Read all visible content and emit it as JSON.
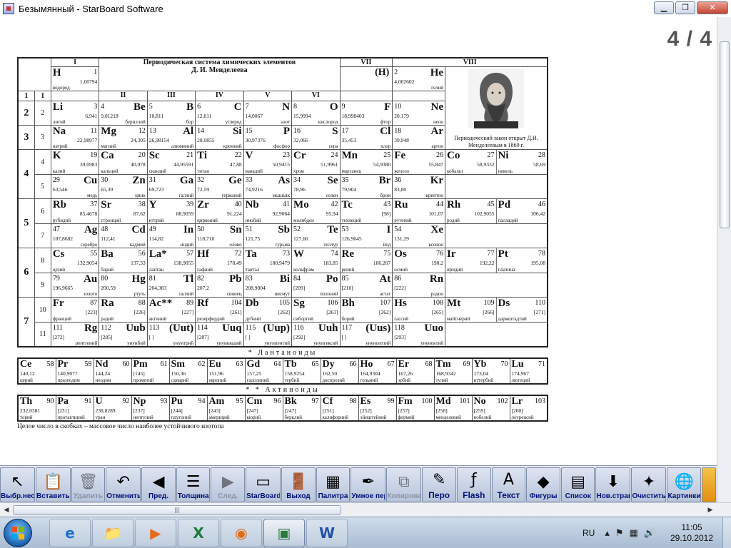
{
  "window": {
    "title": "Безымянный - StarBoard Software",
    "minimize": "▁",
    "maximize": "❐",
    "close": "✕"
  },
  "canvas": {
    "page_indicator": "4 / 4"
  },
  "table": {
    "groups": [
      "I",
      "II",
      "III",
      "IV",
      "V",
      "VI",
      "VII",
      "VIII"
    ],
    "title_line1": "Периодическая система химических элементов",
    "title_line2": "Д. И. Менделеева",
    "h_group7": "(H)",
    "periods": [
      "1",
      "2",
      "3",
      "4",
      "5",
      "6",
      "7"
    ],
    "rows": [
      "1",
      "2",
      "3",
      "4",
      "5",
      "6",
      "7",
      "8",
      "9",
      "10",
      "11"
    ],
    "portrait_caption": "Периодический закон открыт Д.И. Менделеевым в 1869 г.",
    "elements": {
      "H": {
        "sym": "H",
        "num": "1",
        "mass": "1,00794",
        "name": "водород"
      },
      "He": {
        "sym": "He",
        "num": "2",
        "mass": "4,002602",
        "name": "гелий"
      },
      "Li": {
        "sym": "Li",
        "num": "3",
        "mass": "6,941",
        "name": "литий"
      },
      "Be": {
        "sym": "Be",
        "num": "4",
        "mass": "9,01218",
        "name": "бериллий"
      },
      "B": {
        "sym": "B",
        "num": "5",
        "mass": "10,811",
        "name": "бор"
      },
      "C": {
        "sym": "C",
        "num": "6",
        "mass": "12,011",
        "name": "углерод"
      },
      "N": {
        "sym": "N",
        "num": "7",
        "mass": "14,0067",
        "name": "азот"
      },
      "O": {
        "sym": "O",
        "num": "8",
        "mass": "15,9994",
        "name": "кислород"
      },
      "F": {
        "sym": "F",
        "num": "9",
        "mass": "18,998403",
        "name": "фтор"
      },
      "Ne": {
        "sym": "Ne",
        "num": "10",
        "mass": "20,179",
        "name": "неон"
      },
      "Na": {
        "sym": "Na",
        "num": "11",
        "mass": "22,98977",
        "name": "натрий"
      },
      "Mg": {
        "sym": "Mg",
        "num": "12",
        "mass": "24,305",
        "name": "магний"
      },
      "Al": {
        "sym": "Al",
        "num": "13",
        "mass": "26,98154",
        "name": "алюминий"
      },
      "Si": {
        "sym": "Si",
        "num": "14",
        "mass": "28,0855",
        "name": "кремний"
      },
      "P": {
        "sym": "P",
        "num": "15",
        "mass": "30,97376",
        "name": "фосфор"
      },
      "S": {
        "sym": "S",
        "num": "16",
        "mass": "32,066",
        "name": "сера"
      },
      "Cl": {
        "sym": "Cl",
        "num": "17",
        "mass": "35,453",
        "name": "хлор"
      },
      "Ar": {
        "sym": "Ar",
        "num": "18",
        "mass": "39,948",
        "name": "аргон"
      },
      "K": {
        "sym": "K",
        "num": "19",
        "mass": "39,0983",
        "name": "калий"
      },
      "Ca": {
        "sym": "Ca",
        "num": "20",
        "mass": "40,078",
        "name": "кальций"
      },
      "Sc": {
        "sym": "Sc",
        "num": "21",
        "mass": "44,95591",
        "name": "скандий"
      },
      "Ti": {
        "sym": "Ti",
        "num": "22",
        "mass": "47,88",
        "name": "титан"
      },
      "V": {
        "sym": "V",
        "num": "23",
        "mass": "50,9415",
        "name": "ванадий"
      },
      "Cr": {
        "sym": "Cr",
        "num": "24",
        "mass": "51,9961",
        "name": "хром"
      },
      "Mn": {
        "sym": "Mn",
        "num": "25",
        "mass": "54,9380",
        "name": "марганец"
      },
      "Fe": {
        "sym": "Fe",
        "num": "26",
        "mass": "55,847",
        "name": "железо"
      },
      "Co": {
        "sym": "Co",
        "num": "27",
        "mass": "58,9332",
        "name": "кобальт"
      },
      "Ni": {
        "sym": "Ni",
        "num": "28",
        "mass": "58,69",
        "name": "никель"
      },
      "Cu": {
        "sym": "Cu",
        "num": "29",
        "mass": "63,546",
        "name": "медь"
      },
      "Zn": {
        "sym": "Zn",
        "num": "30",
        "mass": "65,39",
        "name": "цинк"
      },
      "Ga": {
        "sym": "Ga",
        "num": "31",
        "mass": "69,723",
        "name": "галлий"
      },
      "Ge": {
        "sym": "Ge",
        "num": "32",
        "mass": "72,59",
        "name": "германий"
      },
      "As": {
        "sym": "As",
        "num": "33",
        "mass": "74,9216",
        "name": "мышьяк"
      },
      "Se": {
        "sym": "Se",
        "num": "34",
        "mass": "78,96",
        "name": "селен"
      },
      "Br": {
        "sym": "Br",
        "num": "35",
        "mass": "79,904",
        "name": "бром"
      },
      "Kr": {
        "sym": "Kr",
        "num": "36",
        "mass": "83,80",
        "name": "криптон"
      },
      "Rb": {
        "sym": "Rb",
        "num": "37",
        "mass": "85,4678",
        "name": "рубидий"
      },
      "Sr": {
        "sym": "Sr",
        "num": "38",
        "mass": "87,62",
        "name": "стронций"
      },
      "Y": {
        "sym": "Y",
        "num": "39",
        "mass": "88,9059",
        "name": "иттрий"
      },
      "Zr": {
        "sym": "Zr",
        "num": "40",
        "mass": "91,224",
        "name": "цирконий"
      },
      "Nb": {
        "sym": "Nb",
        "num": "41",
        "mass": "92,9064",
        "name": "ниобий"
      },
      "Mo": {
        "sym": "Mo",
        "num": "42",
        "mass": "95,94",
        "name": "молибден"
      },
      "Tc": {
        "sym": "Tc",
        "num": "43",
        "mass": "[98]",
        "name": "технеций"
      },
      "Ru": {
        "sym": "Ru",
        "num": "44",
        "mass": "101,07",
        "name": "рутений"
      },
      "Rh": {
        "sym": "Rh",
        "num": "45",
        "mass": "102,9055",
        "name": "родий"
      },
      "Pd": {
        "sym": "Pd",
        "num": "46",
        "mass": "106,42",
        "name": "палладий"
      },
      "Ag": {
        "sym": "Ag",
        "num": "47",
        "mass": "107,8682",
        "name": "серебро"
      },
      "Cd": {
        "sym": "Cd",
        "num": "48",
        "mass": "112,41",
        "name": "кадмий"
      },
      "In": {
        "sym": "In",
        "num": "49",
        "mass": "114,82",
        "name": "индий"
      },
      "Sn": {
        "sym": "Sn",
        "num": "50",
        "mass": "118,710",
        "name": "олово"
      },
      "Sb": {
        "sym": "Sb",
        "num": "51",
        "mass": "121,75",
        "name": "сурьма"
      },
      "Te": {
        "sym": "Te",
        "num": "52",
        "mass": "127,60",
        "name": "теллур"
      },
      "I": {
        "sym": "I",
        "num": "53",
        "mass": "126,9045",
        "name": "йод"
      },
      "Xe": {
        "sym": "Xe",
        "num": "54",
        "mass": "131,29",
        "name": "ксенон"
      },
      "Cs": {
        "sym": "Cs",
        "num": "55",
        "mass": "132,9054",
        "name": "цезий"
      },
      "Ba": {
        "sym": "Ba",
        "num": "56",
        "mass": "137,33",
        "name": "барий"
      },
      "La": {
        "sym": "La*",
        "num": "57",
        "mass": "138,9055",
        "name": "лантан"
      },
      "Hf": {
        "sym": "Hf",
        "num": "72",
        "mass": "178,49",
        "name": "гафний"
      },
      "Ta": {
        "sym": "Ta",
        "num": "73",
        "mass": "180,9479",
        "name": "тантал"
      },
      "W": {
        "sym": "W",
        "num": "74",
        "mass": "183,85",
        "name": "вольфрам"
      },
      "Re": {
        "sym": "Re",
        "num": "75",
        "mass": "186,207",
        "name": "рений"
      },
      "Os": {
        "sym": "Os",
        "num": "76",
        "mass": "190,2",
        "name": "осмий"
      },
      "Ir": {
        "sym": "Ir",
        "num": "77",
        "mass": "192,22",
        "name": "иридий"
      },
      "Pt": {
        "sym": "Pt",
        "num": "78",
        "mass": "195,08",
        "name": "платина"
      },
      "Au": {
        "sym": "Au",
        "num": "79",
        "mass": "196,9665",
        "name": "золото"
      },
      "Hg": {
        "sym": "Hg",
        "num": "80",
        "mass": "200,59",
        "name": "ртуть"
      },
      "Tl": {
        "sym": "Tl",
        "num": "81",
        "mass": "204,383",
        "name": "таллий"
      },
      "Pb": {
        "sym": "Pb",
        "num": "82",
        "mass": "207,2",
        "name": "свинец"
      },
      "Bi": {
        "sym": "Bi",
        "num": "83",
        "mass": "208,9804",
        "name": "висмут"
      },
      "Po": {
        "sym": "Po",
        "num": "84",
        "mass": "[209]",
        "name": "полоний"
      },
      "At": {
        "sym": "At",
        "num": "85",
        "mass": "[210]",
        "name": "астат"
      },
      "Rn": {
        "sym": "Rn",
        "num": "86",
        "mass": "[222]",
        "name": "радон"
      },
      "Fr": {
        "sym": "Fr",
        "num": "87",
        "mass": "[223]",
        "name": "франций"
      },
      "Ra": {
        "sym": "Ra",
        "num": "88",
        "mass": "[226]",
        "name": "радий"
      },
      "Ac": {
        "sym": "Ac**",
        "num": "89",
        "mass": "[227]",
        "name": "актиний"
      },
      "Rf": {
        "sym": "Rf",
        "num": "104",
        "mass": "[261]",
        "name": "резерфордий"
      },
      "Db": {
        "sym": "Db",
        "num": "105",
        "mass": "[262]",
        "name": "дубний"
      },
      "Sg": {
        "sym": "Sg",
        "num": "106",
        "mass": "[263]",
        "name": "сиборгий"
      },
      "Bh": {
        "sym": "Bh",
        "num": "107",
        "mass": "[262]",
        "name": "борий"
      },
      "Hs": {
        "sym": "Hs",
        "num": "108",
        "mass": "[265]",
        "name": "гассий"
      },
      "Mt": {
        "sym": "Mt",
        "num": "109",
        "mass": "[266]",
        "name": "майтнерий"
      },
      "Ds": {
        "sym": "Ds",
        "num": "110",
        "mass": "[271]",
        "name": "дармштадтий"
      },
      "Rg": {
        "sym": "Rg",
        "num": "111",
        "mass": "[272]",
        "name": "рентгений"
      },
      "Uub": {
        "sym": "Uub",
        "num": "112",
        "mass": "[285]",
        "name": "унунбий"
      },
      "Uut": {
        "sym": "(Uut)",
        "num": "113",
        "mass": "[  ]",
        "name": "унунтрий"
      },
      "Uuq": {
        "sym": "Uuq",
        "num": "114",
        "mass": "[287]",
        "name": "унунквадий"
      },
      "Uup": {
        "sym": "(Uup)",
        "num": "115",
        "mass": "[  ]",
        "name": "унунпентий"
      },
      "Uuh": {
        "sym": "Uuh",
        "num": "116",
        "mass": "[292]",
        "name": "унунгексий"
      },
      "Uus": {
        "sym": "(Uus)",
        "num": "117",
        "mass": "[  ]",
        "name": "унунсептий"
      },
      "Uuo": {
        "sym": "Uuo",
        "num": "118",
        "mass": "[293]",
        "name": "унуноктий"
      }
    },
    "lanthanides_label": "* Лантаноиды",
    "actinides_label": "* * Актиноиды",
    "lanthanides": [
      {
        "sym": "Ce",
        "num": "58",
        "mass": "140,12",
        "name": "церий"
      },
      {
        "sym": "Pr",
        "num": "59",
        "mass": "140,9077",
        "name": "празеодим"
      },
      {
        "sym": "Nd",
        "num": "60",
        "mass": "144,24",
        "name": "неодим"
      },
      {
        "sym": "Pm",
        "num": "61",
        "mass": "[145]",
        "name": "прометий"
      },
      {
        "sym": "Sm",
        "num": "62",
        "mass": "150,36",
        "name": "самарий"
      },
      {
        "sym": "Eu",
        "num": "63",
        "mass": "151,96",
        "name": "европий"
      },
      {
        "sym": "Gd",
        "num": "64",
        "mass": "157,25",
        "name": "гадолиний"
      },
      {
        "sym": "Tb",
        "num": "65",
        "mass": "158,9254",
        "name": "тербий"
      },
      {
        "sym": "Dy",
        "num": "66",
        "mass": "162,50",
        "name": "диспрозий"
      },
      {
        "sym": "Ho",
        "num": "67",
        "mass": "164,9304",
        "name": "гольмий"
      },
      {
        "sym": "Er",
        "num": "68",
        "mass": "167,26",
        "name": "эрбий"
      },
      {
        "sym": "Tm",
        "num": "69",
        "mass": "168,9342",
        "name": "тулий"
      },
      {
        "sym": "Yb",
        "num": "70",
        "mass": "173,04",
        "name": "иттербий"
      },
      {
        "sym": "Lu",
        "num": "71",
        "mass": "174,967",
        "name": "лютеций"
      }
    ],
    "actinides": [
      {
        "sym": "Th",
        "num": "90",
        "mass": "232,0381",
        "name": "торий"
      },
      {
        "sym": "Pa",
        "num": "91",
        "mass": "[231]",
        "name": "протактиний"
      },
      {
        "sym": "U",
        "num": "92",
        "mass": "238,0289",
        "name": "уран"
      },
      {
        "sym": "Np",
        "num": "93",
        "mass": "[237]",
        "name": "нептуний"
      },
      {
        "sym": "Pu",
        "num": "94",
        "mass": "[244]",
        "name": "плутоний"
      },
      {
        "sym": "Am",
        "num": "95",
        "mass": "[243]",
        "name": "америций"
      },
      {
        "sym": "Cm",
        "num": "96",
        "mass": "[247]",
        "name": "кюрий"
      },
      {
        "sym": "Bk",
        "num": "97",
        "mass": "[247]",
        "name": "берклий"
      },
      {
        "sym": "Cf",
        "num": "98",
        "mass": "[251]",
        "name": "калифорний"
      },
      {
        "sym": "Es",
        "num": "99",
        "mass": "[252]",
        "name": "эйнштейний"
      },
      {
        "sym": "Fm",
        "num": "100",
        "mass": "[257]",
        "name": "фермий"
      },
      {
        "sym": "Md",
        "num": "101",
        "mass": "[258]",
        "name": "менделевий"
      },
      {
        "sym": "No",
        "num": "102",
        "mass": "[259]",
        "name": "нобелий"
      },
      {
        "sym": "Lr",
        "num": "103",
        "mass": "[260]",
        "name": "лоуренсий"
      }
    ],
    "footnote": "Целое число в скобках – массовое число наиболее устойчивого изотопа"
  },
  "toolbar": {
    "buttons": [
      {
        "id": "select-mode",
        "label": "Выбр.неск.",
        "icon": "cursor-plus-icon",
        "glyph": "↖",
        "disabled": false
      },
      {
        "id": "paste",
        "label": "Вставить",
        "icon": "clipboard-icon",
        "glyph": "📋",
        "disabled": false
      },
      {
        "id": "delete",
        "label": "Удалить",
        "icon": "trash-icon",
        "glyph": "🗑",
        "disabled": true
      },
      {
        "id": "undo",
        "label": "Отменить",
        "icon": "undo-icon",
        "glyph": "↶",
        "disabled": false
      },
      {
        "id": "prev-page",
        "label": "Пред.",
        "icon": "prev-page-icon",
        "glyph": "◀",
        "disabled": false
      },
      {
        "id": "thickness",
        "label": "Толщина",
        "icon": "line-thickness-icon",
        "glyph": "☰",
        "disabled": false
      },
      {
        "id": "next-page",
        "label": "След.",
        "icon": "next-page-icon",
        "glyph": "▶",
        "disabled": true
      },
      {
        "id": "starboard",
        "label": "StarBoard",
        "icon": "board-icon",
        "glyph": "▭",
        "disabled": false
      },
      {
        "id": "exit",
        "label": "Выход",
        "icon": "door-icon",
        "glyph": "🚪",
        "disabled": false
      },
      {
        "id": "palette",
        "label": "Палитра",
        "icon": "palette-icon",
        "glyph": "▦",
        "disabled": false
      },
      {
        "id": "smart-pen",
        "label": "Умное перо",
        "icon": "smart-pen-icon",
        "glyph": "✒",
        "disabled": false
      },
      {
        "id": "copy",
        "label": "Копировать",
        "icon": "copy-icon",
        "glyph": "⧉",
        "disabled": true
      },
      {
        "id": "pen",
        "label": "Перо",
        "icon": "pen-icon",
        "glyph": "✎",
        "disabled": false,
        "big": true
      },
      {
        "id": "flash",
        "label": "Flash",
        "icon": "flash-icon",
        "glyph": "ƒ",
        "disabled": false,
        "big": true
      },
      {
        "id": "text",
        "label": "Текст",
        "icon": "text-icon",
        "glyph": "A",
        "disabled": false,
        "big": true
      },
      {
        "id": "shapes",
        "label": "Фигуры",
        "icon": "shapes-icon",
        "glyph": "◆",
        "disabled": false
      },
      {
        "id": "list",
        "label": "Список",
        "icon": "list-icon",
        "glyph": "▤",
        "disabled": false
      },
      {
        "id": "new-page",
        "label": "Нов.стран.",
        "icon": "new-page-icon",
        "glyph": "⬇",
        "disabled": false
      },
      {
        "id": "clear",
        "label": "Очистить",
        "icon": "clear-icon",
        "glyph": "✦",
        "disabled": false
      },
      {
        "id": "pictures",
        "label": "Картинки",
        "icon": "pictures-icon",
        "glyph": "🌐",
        "disabled": false
      }
    ]
  },
  "hscroll": {
    "left_arrow": "◀",
    "right_arrow": "▶",
    "thumb_grip": "|||"
  },
  "taskbar": {
    "apps": [
      {
        "id": "ie",
        "icon": "internet-explorer-icon",
        "glyph": "e",
        "color": "#1d6fd0",
        "active": false
      },
      {
        "id": "explorer",
        "icon": "folder-icon",
        "glyph": "📁",
        "color": "#d9a93a",
        "active": false
      },
      {
        "id": "media",
        "icon": "media-player-icon",
        "glyph": "▶",
        "color": "#e56a1c",
        "active": false
      },
      {
        "id": "excel",
        "icon": "excel-icon",
        "glyph": "X",
        "color": "#1e7b3a",
        "active": false
      },
      {
        "id": "firefox",
        "icon": "firefox-icon",
        "glyph": "◉",
        "color": "#e06a10",
        "active": false
      },
      {
        "id": "starboard",
        "icon": "starboard-icon",
        "glyph": "▣",
        "color": "#2c7a3c",
        "active": true
      },
      {
        "id": "word",
        "icon": "word-icon",
        "glyph": "W",
        "color": "#2250a8",
        "active": false
      }
    ],
    "lang": "RU",
    "time": "11:05",
    "date": "29.10.2012"
  }
}
